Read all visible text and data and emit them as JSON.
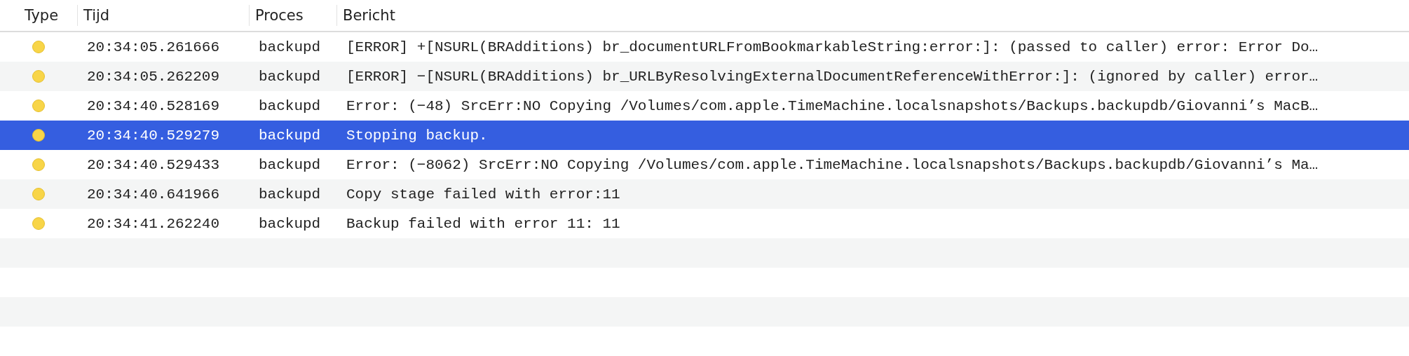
{
  "table": {
    "columns": [
      "Type",
      "Tijd",
      "Proces",
      "Bericht"
    ],
    "rows": [
      {
        "time": "20:34:05.261666",
        "process": "backupd",
        "message": "[ERROR] +[NSURL(BRAdditions) br_documentURLFromBookmarkableString:error:]: (passed to caller) error: Error Do…",
        "selected": false
      },
      {
        "time": "20:34:05.262209",
        "process": "backupd",
        "message": "[ERROR] −[NSURL(BRAdditions) br_URLByResolvingExternalDocumentReferenceWithError:]: (ignored by caller) error…",
        "selected": false
      },
      {
        "time": "20:34:40.528169",
        "process": "backupd",
        "message": "Error: (−48) SrcErr:NO Copying /Volumes/com.apple.TimeMachine.localsnapshots/Backups.backupdb/Giovanni’s MacB…",
        "selected": false
      },
      {
        "time": "20:34:40.529279",
        "process": "backupd",
        "message": "Stopping backup.",
        "selected": true
      },
      {
        "time": "20:34:40.529433",
        "process": "backupd",
        "message": "Error: (−8062) SrcErr:NO Copying /Volumes/com.apple.TimeMachine.localsnapshots/Backups.backupdb/Giovanni’s Ma…",
        "selected": false
      },
      {
        "time": "20:34:40.641966",
        "process": "backupd",
        "message": "Copy stage failed with error:11",
        "selected": false
      },
      {
        "time": "20:34:41.262240",
        "process": "backupd",
        "message": "Backup failed with error 11: 11",
        "selected": false
      }
    ]
  }
}
